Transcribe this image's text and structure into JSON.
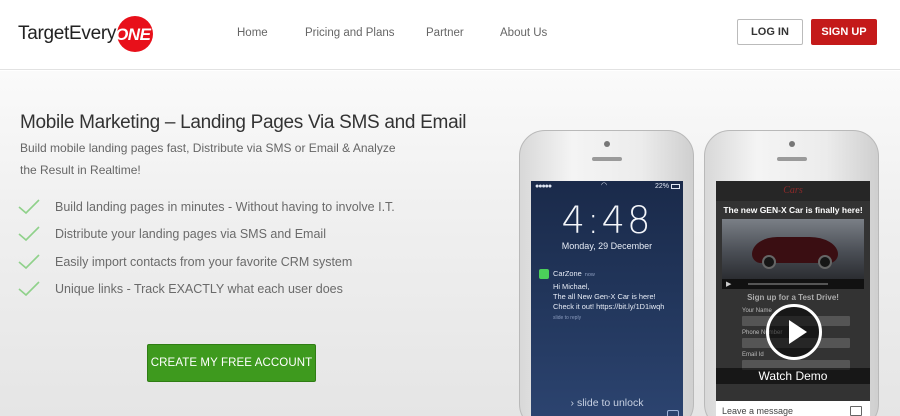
{
  "header": {
    "logo_text": "TargetEvery",
    "logo_badge": "ONE",
    "nav": [
      "Home",
      "Pricing and Plans",
      "Partner",
      "About Us"
    ],
    "login_label": "LOG IN",
    "signup_label": "SIGN UP",
    "accent_color": "#c41a1a"
  },
  "hero": {
    "title": "Mobile Marketing – Landing Pages Via SMS and Email",
    "subtitle": "Build mobile landing pages fast, Distribute via SMS or Email & Analyze the Result in Realtime!",
    "features": [
      "Build landing pages in minutes - Without having to involve I.T.",
      "Distribute your landing pages via SMS and Email",
      "Easily import contacts from your favorite CRM system",
      "Unique links - Track EXACTLY what each user does"
    ],
    "cta_label": "CREATE MY FREE ACCOUNT",
    "cta_color": "#3e9a1e"
  },
  "phone1": {
    "battery": "22%",
    "time": "4:48",
    "date": "Monday, 29 December",
    "notification": {
      "app": "CarZone",
      "when": "now",
      "message": "Hi Michael,\nThe all New Gen-X Car is here!\nCheck it out! https://bit.ly/1D1iwqh",
      "reply_hint": "slide to reply"
    },
    "unlock_text": "slide to unlock"
  },
  "phone2": {
    "brand": "Cars",
    "title": "The new GEN-X Car is finally here!",
    "cta_heading": "Sign up for a Test Drive!",
    "field_labels": [
      "Your Name",
      "Phone Number",
      "Email Id"
    ],
    "video_label": "Watch Demo",
    "chat_label": "Leave a message"
  }
}
